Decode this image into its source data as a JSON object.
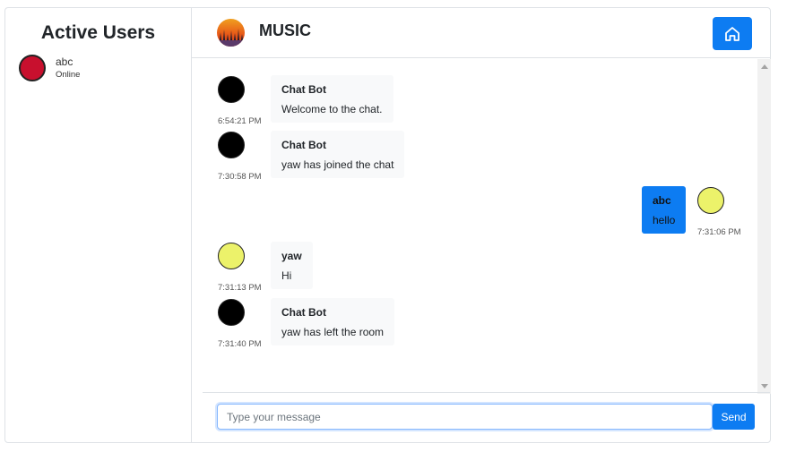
{
  "sidebar": {
    "title": "Active Users",
    "users": [
      {
        "name": "abc",
        "status": "Online",
        "avatar_color": "#c8102e"
      }
    ]
  },
  "header": {
    "room_name": "MUSIC",
    "home_icon": "home-icon"
  },
  "messages": [
    {
      "author": "Chat Bot",
      "text": "Welcome to the chat.",
      "time": "6:54:21 PM",
      "side": "left",
      "avatar_color": "#000000"
    },
    {
      "author": "Chat Bot",
      "text": "yaw has joined the chat",
      "time": "7:30:58 PM",
      "side": "left",
      "avatar_color": "#000000"
    },
    {
      "author": "abc",
      "text": "hello",
      "time": "7:31:06 PM",
      "side": "right",
      "avatar_color": "#ecf26a"
    },
    {
      "author": "yaw",
      "text": "Hi",
      "time": "7:31:13 PM",
      "side": "left",
      "avatar_color": "#ecf26a"
    },
    {
      "author": "Chat Bot",
      "text": "yaw has left the room",
      "time": "7:31:40 PM",
      "side": "left",
      "avatar_color": "#000000"
    }
  ],
  "composer": {
    "placeholder": "Type your message",
    "value": "",
    "send_label": "Send"
  },
  "colors": {
    "accent": "#0d7cf2",
    "bubble_bg": "#f8f9fa"
  }
}
